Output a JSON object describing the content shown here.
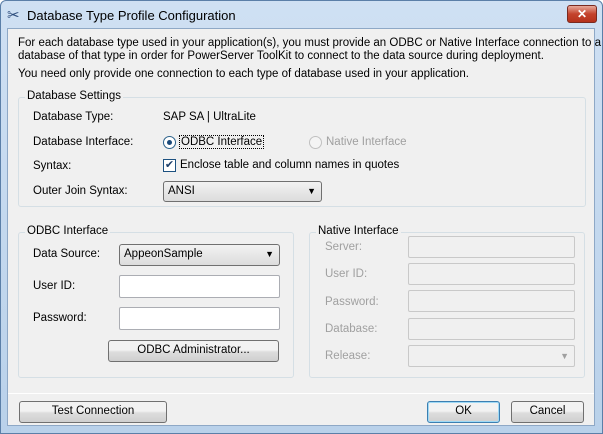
{
  "window": {
    "title": "Database Type Profile Configuration",
    "close": "✕"
  },
  "intro": {
    "line1": "For each database type used in your application(s), you must provide an ODBC or Native Interface connection to a",
    "line2": "database of that type in order for PowerServer ToolKit to connect to the data source during deployment.",
    "line3": "You need only provide one connection to each type of database used in your application."
  },
  "db_settings": {
    "title": "Database Settings",
    "type_label": "Database Type:",
    "type_value": "SAP SA | UltraLite",
    "interface_label": "Database Interface:",
    "odbc_option": "ODBC Interface",
    "native_option": "Native Interface",
    "selected_interface": "ODBC Interface",
    "syntax_label": "Syntax:",
    "syntax_check": "Enclose table and column names in quotes",
    "syntax_checked": true,
    "outer_join_label": "Outer Join Syntax:",
    "outer_join_value": "ANSI"
  },
  "odbc": {
    "title": "ODBC Interface",
    "data_source_label": "Data Source:",
    "data_source_value": "AppeonSample",
    "user_label": "User ID:",
    "user_value": "",
    "password_label": "Password:",
    "password_value": "",
    "admin_button": "ODBC Administrator..."
  },
  "native": {
    "title": "Native Interface",
    "server_label": "Server:",
    "user_label": "User ID:",
    "password_label": "Password:",
    "database_label": "Database:",
    "release_label": "Release:"
  },
  "footer": {
    "test_button": "Test Connection",
    "ok_button": "OK",
    "cancel_button": "Cancel"
  }
}
